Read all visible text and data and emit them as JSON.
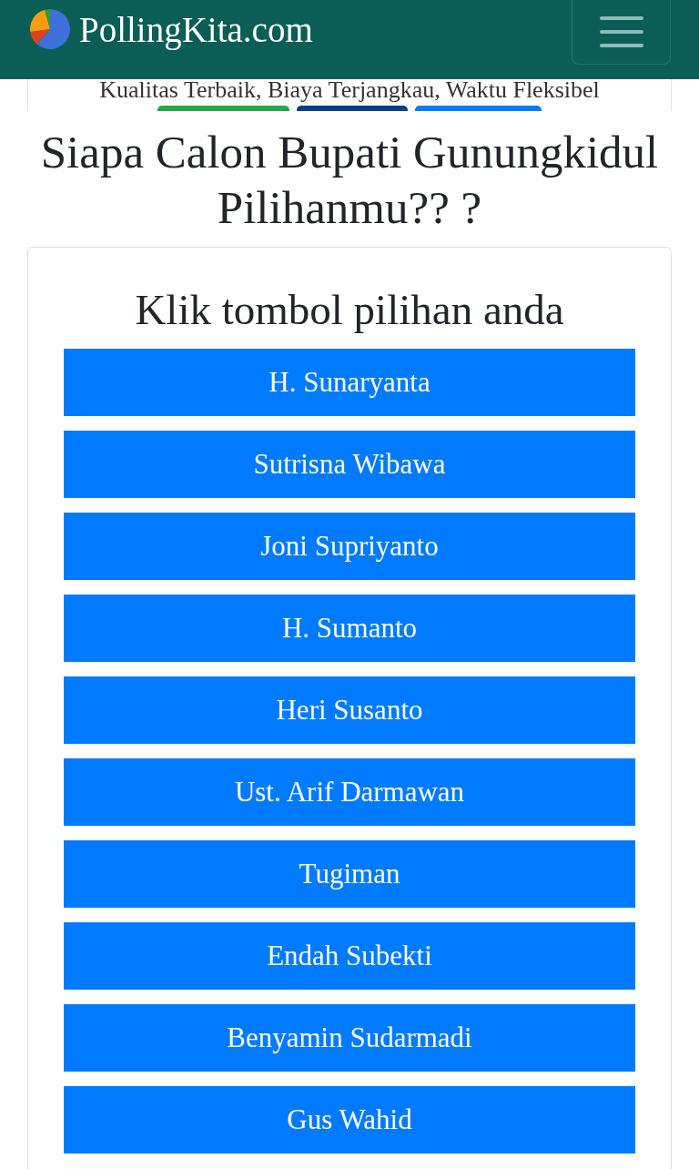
{
  "header": {
    "brand": "PollingKita.com"
  },
  "banner": {
    "tagline": "Kualitas Terbaik, Biaya Terjangkau, Waktu Fleksibel",
    "buttons": [
      {
        "color": "#28a745"
      },
      {
        "color": "#004085"
      },
      {
        "color": "#007bff"
      }
    ]
  },
  "title": "Siapa Calon Bupati Gunungkidul Pilihanmu?? ?",
  "card": {
    "heading": "Klik tombol pilihan anda",
    "options": [
      "H. Sunaryanta",
      "Sutrisna Wibawa",
      "Joni Supriyanto",
      "H. Sumanto",
      "Heri Susanto",
      "Ust. Arif Darmawan",
      "Tugiman",
      "Endah Subekti",
      "Benyamin Sudarmadi",
      "Gus Wahid"
    ]
  }
}
